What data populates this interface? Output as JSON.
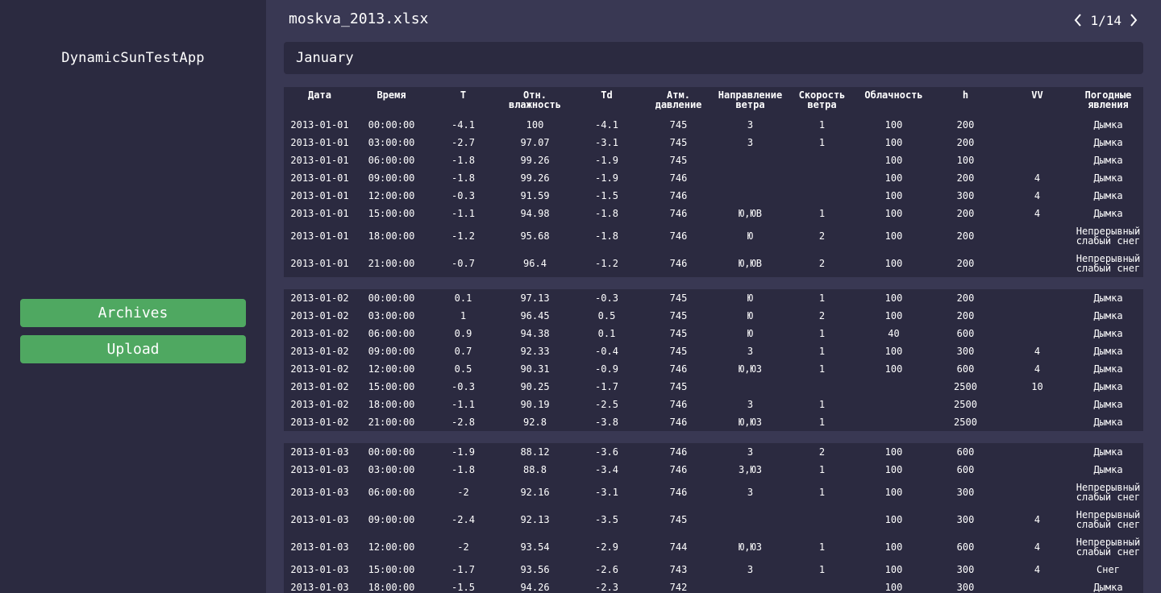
{
  "app": {
    "title": "DynamicSunTestApp"
  },
  "sidebar": {
    "archives_label": "Archives",
    "upload_label": "Upload"
  },
  "header": {
    "file_name": "moskva_2013.xlsx",
    "page_indicator": "1/14"
  },
  "month": {
    "label": "January"
  },
  "table": {
    "columns": [
      "Дата",
      "Время",
      "T",
      "Отн. влажность",
      "Td",
      "Атм. давление",
      "Направление ветра",
      "Скорость ветра",
      "Облачность",
      "h",
      "VV",
      "Погодные явления"
    ],
    "blocks": [
      [
        [
          "2013-01-01",
          "00:00:00",
          "-4.1",
          "100",
          "-4.1",
          "745",
          "З",
          "1",
          "100",
          "200",
          "",
          "Дымка"
        ],
        [
          "2013-01-01",
          "03:00:00",
          "-2.7",
          "97.07",
          "-3.1",
          "745",
          "З",
          "1",
          "100",
          "200",
          "",
          "Дымка"
        ],
        [
          "2013-01-01",
          "06:00:00",
          "-1.8",
          "99.26",
          "-1.9",
          "745",
          "",
          "",
          "100",
          "100",
          "",
          "Дымка"
        ],
        [
          "2013-01-01",
          "09:00:00",
          "-1.8",
          "99.26",
          "-1.9",
          "746",
          "",
          "",
          "100",
          "200",
          "4",
          "Дымка"
        ],
        [
          "2013-01-01",
          "12:00:00",
          "-0.3",
          "91.59",
          "-1.5",
          "746",
          "",
          "",
          "100",
          "300",
          "4",
          "Дымка"
        ],
        [
          "2013-01-01",
          "15:00:00",
          "-1.1",
          "94.98",
          "-1.8",
          "746",
          "Ю,ЮВ",
          "1",
          "100",
          "200",
          "4",
          "Дымка"
        ],
        [
          "2013-01-01",
          "18:00:00",
          "-1.2",
          "95.68",
          "-1.8",
          "746",
          "Ю",
          "2",
          "100",
          "200",
          "",
          "Непрерывный слабый снег"
        ],
        [
          "2013-01-01",
          "21:00:00",
          "-0.7",
          "96.4",
          "-1.2",
          "746",
          "Ю,ЮВ",
          "2",
          "100",
          "200",
          "",
          "Непрерывный слабый снег"
        ]
      ],
      [
        [
          "2013-01-02",
          "00:00:00",
          "0.1",
          "97.13",
          "-0.3",
          "745",
          "Ю",
          "1",
          "100",
          "200",
          "",
          "Дымка"
        ],
        [
          "2013-01-02",
          "03:00:00",
          "1",
          "96.45",
          "0.5",
          "745",
          "Ю",
          "2",
          "100",
          "200",
          "",
          "Дымка"
        ],
        [
          "2013-01-02",
          "06:00:00",
          "0.9",
          "94.38",
          "0.1",
          "745",
          "Ю",
          "1",
          "40",
          "600",
          "",
          "Дымка"
        ],
        [
          "2013-01-02",
          "09:00:00",
          "0.7",
          "92.33",
          "-0.4",
          "745",
          "З",
          "1",
          "100",
          "300",
          "4",
          "Дымка"
        ],
        [
          "2013-01-02",
          "12:00:00",
          "0.5",
          "90.31",
          "-0.9",
          "746",
          "Ю,ЮЗ",
          "1",
          "100",
          "600",
          "4",
          "Дымка"
        ],
        [
          "2013-01-02",
          "15:00:00",
          "-0.3",
          "90.25",
          "-1.7",
          "745",
          "",
          "",
          "",
          "2500",
          "10",
          "Дымка"
        ],
        [
          "2013-01-02",
          "18:00:00",
          "-1.1",
          "90.19",
          "-2.5",
          "746",
          "З",
          "1",
          "",
          "2500",
          "",
          "Дымка"
        ],
        [
          "2013-01-02",
          "21:00:00",
          "-2.8",
          "92.8",
          "-3.8",
          "746",
          "Ю,ЮЗ",
          "1",
          "",
          "2500",
          "",
          "Дымка"
        ]
      ],
      [
        [
          "2013-01-03",
          "00:00:00",
          "-1.9",
          "88.12",
          "-3.6",
          "746",
          "З",
          "2",
          "100",
          "600",
          "",
          "Дымка"
        ],
        [
          "2013-01-03",
          "03:00:00",
          "-1.8",
          "88.8",
          "-3.4",
          "746",
          "З,ЮЗ",
          "1",
          "100",
          "600",
          "",
          "Дымка"
        ],
        [
          "2013-01-03",
          "06:00:00",
          "-2",
          "92.16",
          "-3.1",
          "746",
          "З",
          "1",
          "100",
          "300",
          "",
          "Непрерывный слабый снег"
        ],
        [
          "2013-01-03",
          "09:00:00",
          "-2.4",
          "92.13",
          "-3.5",
          "745",
          "",
          "",
          "100",
          "300",
          "4",
          "Непрерывный слабый снег"
        ],
        [
          "2013-01-03",
          "12:00:00",
          "-2",
          "93.54",
          "-2.9",
          "744",
          "Ю,ЮЗ",
          "1",
          "100",
          "600",
          "4",
          "Непрерывный слабый снег"
        ],
        [
          "2013-01-03",
          "15:00:00",
          "-1.7",
          "93.56",
          "-2.6",
          "743",
          "З",
          "1",
          "100",
          "300",
          "4",
          "Снег"
        ],
        [
          "2013-01-03",
          "18:00:00",
          "-1.5",
          "94.26",
          "-2.3",
          "742",
          "",
          "",
          "100",
          "300",
          "",
          "Дымка"
        ]
      ]
    ]
  }
}
